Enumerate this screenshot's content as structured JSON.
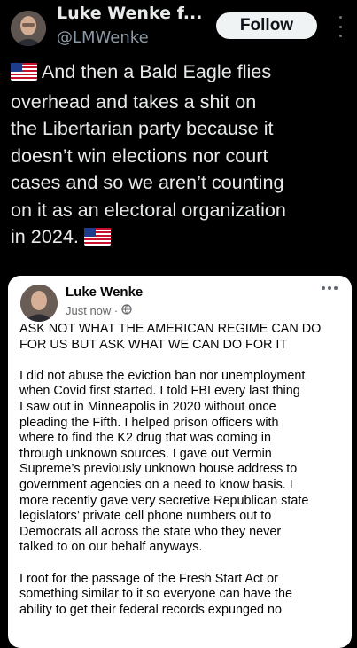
{
  "header": {
    "display_name": "Luke Wenke f...",
    "handle": "@LMWenke",
    "follow_label": "Follow"
  },
  "tweet": {
    "lines": [
      "And then a Bald Eagle flies",
      "overhead and takes a shit on",
      "the Libertarian party because it",
      "doesn’t win elections nor court",
      "cases and so we aren’t counting",
      "on it as an electoral organization",
      "in 2024."
    ]
  },
  "embedded_post": {
    "author": "Luke Wenke",
    "time": "Just now ·",
    "headline_lines": [
      "ASK NOT WHAT THE AMERICAN REGIME CAN DO",
      "FOR US BUT ASK WHAT WE CAN DO FOR IT"
    ],
    "para1_lines": [
      "I did not abuse the eviction ban nor unemployment",
      "when Covid first started.  I told FBI every last thing",
      "I saw out in Minneapolis in 2020 without once",
      "pleading the Fifth.  I helped prison officers with",
      "where to find the K2 drug that was coming in",
      "through unknown sources.  I gave out Vermin",
      "Supreme’s previously unknown house address to",
      "government agencies on a need to know basis.  I",
      "more recently gave very secretive Republican state",
      "legislators’ private cell phone numbers out to",
      "Democrats all across the state who they never",
      "talked to on our behalf anyways."
    ],
    "para2_lines": [
      "I root for the passage of the Fresh Start Act or",
      "something similar to it so everyone can have the",
      "ability to get their federal records expunged no"
    ]
  },
  "icons": {
    "flag": "us-flag-icon",
    "globe": "globe-icon",
    "more": "more-icon"
  },
  "colors": {
    "background": "#000000",
    "text": "#e7e9ea",
    "secondary": "#8b98a5",
    "follow_bg": "#eff3f4",
    "card_bg": "#ffffff"
  }
}
